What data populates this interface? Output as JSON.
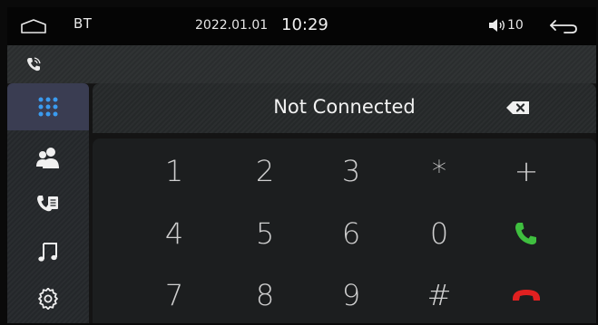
{
  "status_bar": {
    "home_icon": "home-icon",
    "title": "BT",
    "date": "2022.01.01",
    "time": "10:29",
    "volume_icon": "volume-icon",
    "volume": "10",
    "back_icon": "back-arrow-icon"
  },
  "call_status": {
    "icon": "phone-signal-icon"
  },
  "sidebar": {
    "items": [
      {
        "icon": "dialpad-icon",
        "active": true
      },
      {
        "icon": "contacts-icon",
        "active": false
      },
      {
        "icon": "call-log-icon",
        "active": false
      },
      {
        "icon": "music-icon",
        "active": false
      },
      {
        "icon": "settings-icon",
        "active": false
      }
    ]
  },
  "dialer": {
    "display_text": "Not Connected",
    "backspace_icon": "backspace-icon",
    "keys": [
      [
        "1",
        "2",
        "3",
        "*",
        "+"
      ],
      [
        "4",
        "5",
        "6",
        "0",
        "call"
      ],
      [
        "7",
        "8",
        "9",
        "#",
        "hangup"
      ]
    ],
    "colors": {
      "call": "#3fbf3f",
      "hangup": "#e02020",
      "accent": "#2f8de0"
    }
  }
}
